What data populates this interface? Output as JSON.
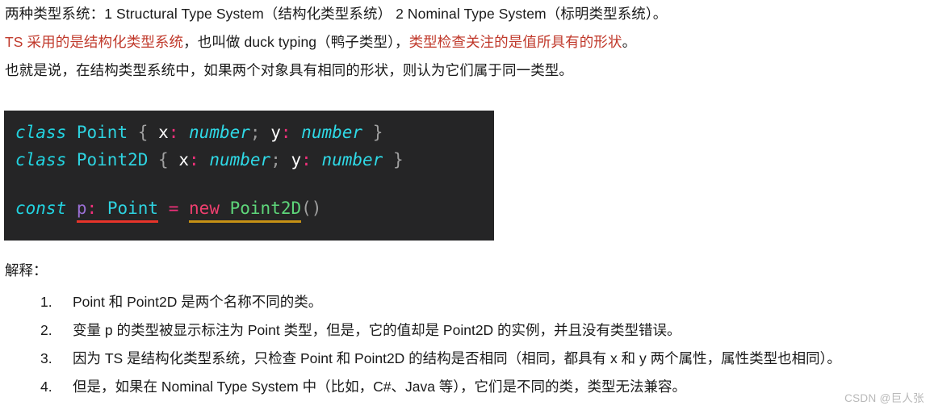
{
  "intro": {
    "line1": "两种类型系统：1 Structural Type System（结构化类型系统） 2 Nominal Type System（标明类型系统）。",
    "line2_red": "TS 采用的是结构化类型系统",
    "line2_mid": "，也叫做 duck typing（鸭子类型），",
    "line2_red2": "类型检查关注的是值所具有的形状",
    "line2_end": "。",
    "line3": "也就是说，在结构类型系统中，如果两个对象具有相同的形状，则认为它们属于同一类型。"
  },
  "code": {
    "line1": {
      "kw": "class",
      "name": "Point",
      "open_brace": "{",
      "prop_x": "x",
      "colon1": ":",
      "type1": "number",
      "semi": ";",
      "prop_y": "y",
      "colon2": ":",
      "type2": "number",
      "close_brace": "}"
    },
    "line2": {
      "kw": "class",
      "name": "Point2D",
      "open_brace": "{",
      "prop_x": "x",
      "colon1": ":",
      "type1": "number",
      "semi": ";",
      "prop_y": "y",
      "colon2": ":",
      "type2": "number",
      "close_brace": "}"
    },
    "line3": {
      "kw": "const",
      "var": "p",
      "colon": ":",
      "type": "Point",
      "eq": "=",
      "new": "new",
      "class": "Point2D",
      "parens": "()"
    },
    "colors": {
      "background": "#252526",
      "keyword": "#22d3e0",
      "type": "#2fd9e6",
      "property": "#ffffff",
      "colon": "#f0307a",
      "punctuation": "#a0a0a0",
      "variable": "#9a6fd4",
      "new_keyword": "#ee3f6e",
      "class_ref": "#5ed67a",
      "error_underline": "#e8342a",
      "warning_underline": "#c79215"
    }
  },
  "explanation": {
    "label": "解释：",
    "items": [
      {
        "num": "1.",
        "text": "Point 和 Point2D 是两个名称不同的类。"
      },
      {
        "num": "2.",
        "text": "变量 p 的类型被显示标注为 Point 类型，但是，它的值却是 Point2D 的实例，并且没有类型错误。"
      },
      {
        "num": "3.",
        "text": "因为 TS 是结构化类型系统，只检查 Point 和 Point2D 的结构是否相同（相同，都具有 x 和 y 两个属性，属性类型也相同）。"
      },
      {
        "num": "4.",
        "text": "但是，如果在 Nominal Type System 中（比如，C#、Java 等），它们是不同的类，类型无法兼容。"
      }
    ]
  },
  "watermark": {
    "text": "CSDN @巨人张"
  },
  "theme": {
    "highlight_red": "#c0392b",
    "body_text": "#1a1a1a",
    "watermark_gray": "#b9b9b9"
  }
}
